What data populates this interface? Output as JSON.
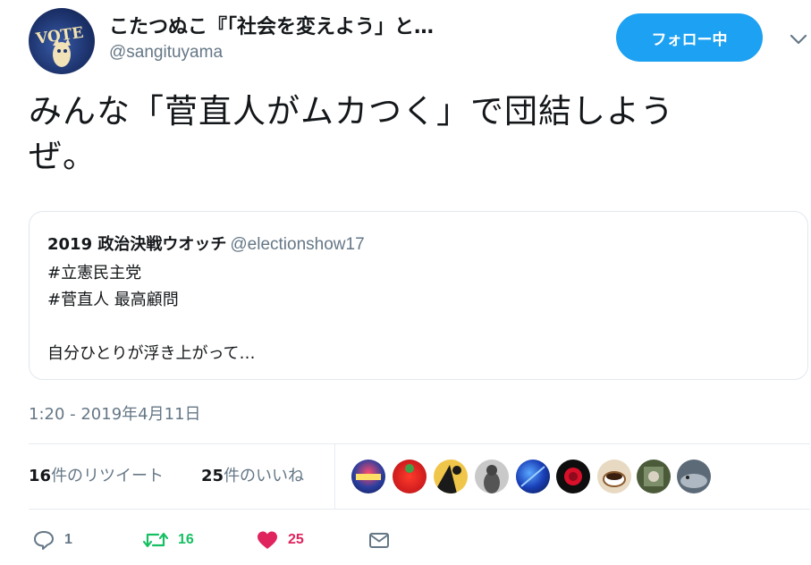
{
  "author": {
    "display_name": "こたつぬこ『「社会を変えよう」と…",
    "screen_name": "@sangituyama",
    "avatar_icon": "vote-avatar"
  },
  "header": {
    "follow_label": "フォロー中",
    "follow_color": "#1da1f2",
    "caret_icon": "chevron-down-icon"
  },
  "tweet": {
    "text_line1": "みんな「菅直人がムカつく」で団結しよう",
    "text_line2": "ぜ。"
  },
  "quote": {
    "author": "2019 政治決戦ウオッチ",
    "handle": "@electionshow17",
    "lines": [
      "#立憲民主党",
      "#菅直人 最高顧問",
      "",
      "自分ひとりが浮き上がって…"
    ]
  },
  "timestamp": "1:20 - 2019年4月11日",
  "stats": {
    "retweets_count": "16",
    "retweets_label": "件のリツイート",
    "likes_count": "25",
    "likes_label": "件のいいね"
  },
  "likers": [
    {
      "icon": "liker-avatar-1"
    },
    {
      "icon": "liker-avatar-2"
    },
    {
      "icon": "liker-avatar-3"
    },
    {
      "icon": "liker-avatar-4"
    },
    {
      "icon": "liker-avatar-5"
    },
    {
      "icon": "liker-avatar-6"
    },
    {
      "icon": "liker-avatar-7"
    },
    {
      "icon": "liker-avatar-8"
    },
    {
      "icon": "liker-avatar-9"
    }
  ],
  "actions": {
    "reply_count": "1",
    "retweet_count": "16",
    "like_count": "25",
    "reply_color": "#657786",
    "retweet_color": "#17bf63",
    "like_color": "#e0245e"
  }
}
